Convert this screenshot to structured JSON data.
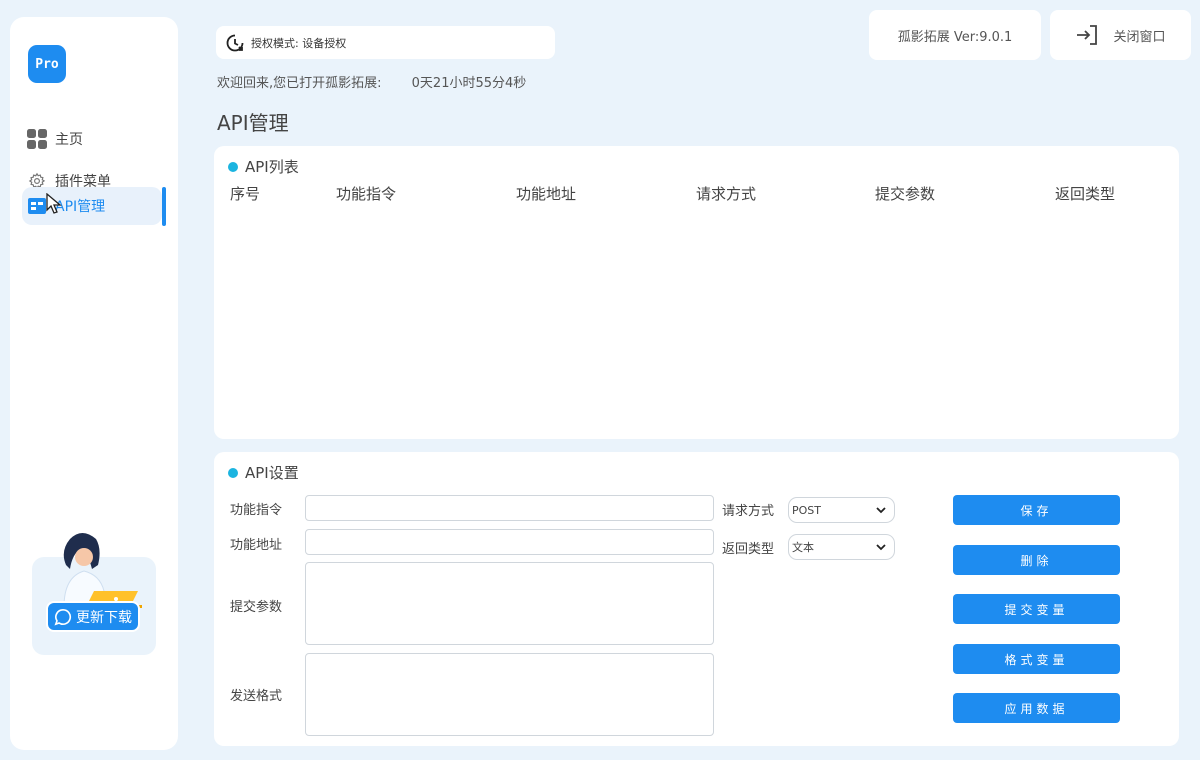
{
  "sidebar": {
    "logo": "Pro",
    "items": [
      {
        "label": "主页"
      },
      {
        "label": "插件菜单"
      },
      {
        "label": "API管理"
      }
    ],
    "promo_button": "更新下载"
  },
  "header": {
    "auth_mode": "授权模式: 设备授权",
    "welcome_text": "欢迎回来,您已打开孤影拓展:",
    "uptime": "0天21小时55分4秒",
    "page_title": "API管理",
    "version": "孤影拓展 Ver:9.0.1",
    "close_label": "关闭窗口"
  },
  "api_list": {
    "title": "API列表",
    "columns": [
      "序号",
      "功能指令",
      "功能地址",
      "请求方式",
      "提交参数",
      "返回类型"
    ],
    "rows": []
  },
  "api_settings": {
    "title": "API设置",
    "labels": {
      "command": "功能指令",
      "address": "功能地址",
      "params": "提交参数",
      "format": "发送格式",
      "method": "请求方式",
      "return_type": "返回类型"
    },
    "values": {
      "command": "",
      "address": "",
      "params": "",
      "format": ""
    },
    "method_selected": "POST",
    "return_type_selected": "文本",
    "buttons": [
      "保存",
      "删除",
      "提交变量",
      "格式变量",
      "应用数据"
    ]
  },
  "colors": {
    "accent": "#1e8cf0",
    "background": "#eaf3fb",
    "dot": "#1bb4e0"
  }
}
